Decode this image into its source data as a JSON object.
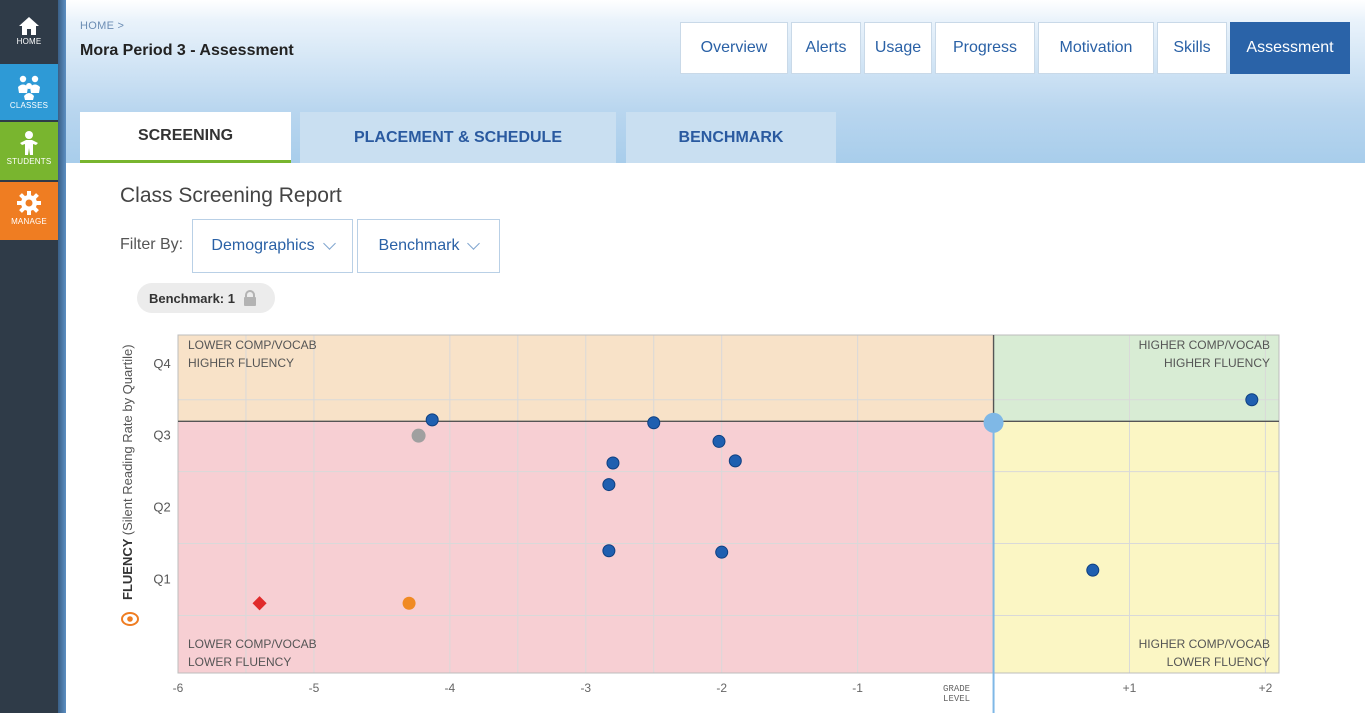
{
  "sidebar": {
    "items": [
      {
        "label": "HOME",
        "icon": "home-icon"
      },
      {
        "label": "CLASSES",
        "icon": "classes-icon"
      },
      {
        "label": "STUDENTS",
        "icon": "student-icon"
      },
      {
        "label": "MANAGE",
        "icon": "gear-icon"
      }
    ]
  },
  "header": {
    "breadcrumb": "HOME  >",
    "title": "Mora Period 3 - Assessment",
    "tabs": [
      "Overview",
      "Alerts",
      "Usage",
      "Progress",
      "Motivation",
      "Skills",
      "Assessment"
    ],
    "active_tab": "Assessment"
  },
  "subtabs": [
    "SCREENING",
    "PLACEMENT & SCHEDULE",
    "BENCHMARK"
  ],
  "report": {
    "title": "Class Screening Report",
    "filter_label": "Filter By:",
    "filters": [
      "Demographics",
      "Benchmark"
    ],
    "benchmark_pill": "Benchmark: 1"
  },
  "chart_data": {
    "type": "scatter",
    "xlim": [
      -6,
      2.1
    ],
    "x_ticks": [
      "-6",
      "-5",
      "-4",
      "-3",
      "-2",
      "-1",
      "+1",
      "+2"
    ],
    "x_tick_values": [
      -6,
      -5,
      -4,
      -3,
      -2,
      -1,
      1,
      2
    ],
    "grade_level_label": "GRADE LEVEL",
    "grade_level_x": 0,
    "ylabel_bold": "FLUENCY",
    "ylabel_rest": "(Silent Reading Rate by Quartile)",
    "ylim": [
      0,
      4.7
    ],
    "y_ticks": [
      "Q1",
      "Q2",
      "Q3",
      "Q4"
    ],
    "y_tick_values": [
      1,
      2,
      3,
      4
    ],
    "quartile_line_y": 3.5,
    "quadrants": {
      "top_left": {
        "line1": "LOWER COMP/VOCAB",
        "line2": "HIGHER FLUENCY",
        "color": "#f8e2c8"
      },
      "top_right": {
        "line1": "HIGHER COMP/VOCAB",
        "line2": "HIGHER FLUENCY",
        "color": "#d8ecd4"
      },
      "bottom_left": {
        "line1": "LOWER COMP/VOCAB",
        "line2": "LOWER FLUENCY",
        "color": "#f7cfd3"
      },
      "bottom_right": {
        "line1": "HIGHER COMP/VOCAB",
        "line2": "LOWER FLUENCY",
        "color": "#fbf6c4"
      }
    },
    "points": [
      {
        "x": -4.13,
        "y": 3.52,
        "kind": "student"
      },
      {
        "x": -4.23,
        "y": 3.3,
        "kind": "inactive"
      },
      {
        "x": -2.5,
        "y": 3.48,
        "kind": "student"
      },
      {
        "x": -2.02,
        "y": 3.22,
        "kind": "student"
      },
      {
        "x": -1.9,
        "y": 2.95,
        "kind": "student"
      },
      {
        "x": -2.8,
        "y": 2.92,
        "kind": "student"
      },
      {
        "x": -2.83,
        "y": 2.62,
        "kind": "student"
      },
      {
        "x": -2.83,
        "y": 1.7,
        "kind": "student"
      },
      {
        "x": -2.0,
        "y": 1.68,
        "kind": "student"
      },
      {
        "x": 0.73,
        "y": 1.43,
        "kind": "student"
      },
      {
        "x": 1.9,
        "y": 3.8,
        "kind": "student"
      },
      {
        "x": -4.3,
        "y": 0.97,
        "kind": "orange"
      },
      {
        "x": -5.4,
        "y": 0.97,
        "kind": "diamond"
      },
      {
        "x": 0,
        "y": 3.48,
        "kind": "grade-marker"
      }
    ],
    "colors": {
      "student": "#1f5fb0",
      "inactive": "#a0a0a0",
      "orange": "#f08a24",
      "diamond": "#e02b2b",
      "grade_marker": "#7fb8e6",
      "grade_line": "#7fb8e6",
      "grid": "#d9d9d9"
    }
  }
}
